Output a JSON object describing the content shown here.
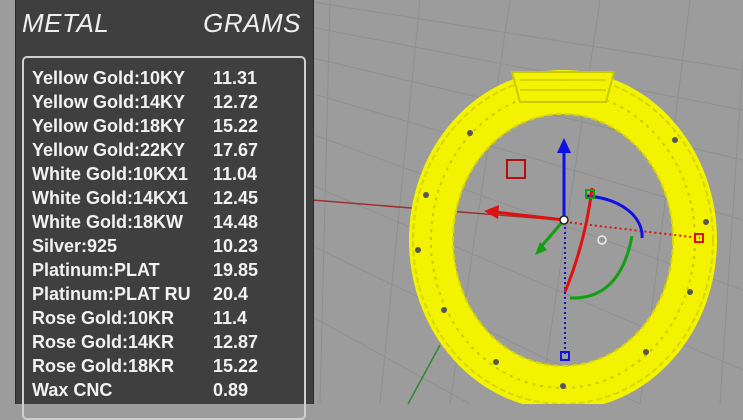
{
  "panel": {
    "header_metal": "METAL",
    "header_grams": "GRAMS",
    "rows": [
      {
        "metal": "Yellow Gold:10KY",
        "grams": "11.31"
      },
      {
        "metal": "Yellow Gold:14KY",
        "grams": "12.72"
      },
      {
        "metal": "Yellow Gold:18KY",
        "grams": "15.22"
      },
      {
        "metal": "Yellow Gold:22KY",
        "grams": "17.67"
      },
      {
        "metal": "White Gold:10KX1",
        "grams": "11.04"
      },
      {
        "metal": "White Gold:14KX1",
        "grams": "12.45"
      },
      {
        "metal": "White Gold:18KW",
        "grams": "14.48"
      },
      {
        "metal": "Silver:925",
        "grams": "10.23"
      },
      {
        "metal": "Platinum:PLAT",
        "grams": "19.85"
      },
      {
        "metal": "Platinum:PLAT RU",
        "grams": "20.4"
      },
      {
        "metal": "Rose Gold:10KR",
        "grams": "11.4"
      },
      {
        "metal": "Rose Gold:14KR",
        "grams": "12.87"
      },
      {
        "metal": "Rose Gold:18KR",
        "grams": "15.22"
      },
      {
        "metal": "Wax  CNC",
        "grams": "0.89"
      }
    ]
  },
  "colors": {
    "viewport_bg": "#9c9c9c",
    "grid_line": "#8d8d8d",
    "x_axis": "#9b3232",
    "y_axis": "#2f8a2f",
    "ring_wire": "#f3f300",
    "gumball_x": "#e01010",
    "gumball_y": "#10a010",
    "gumball_z": "#1010e0"
  }
}
